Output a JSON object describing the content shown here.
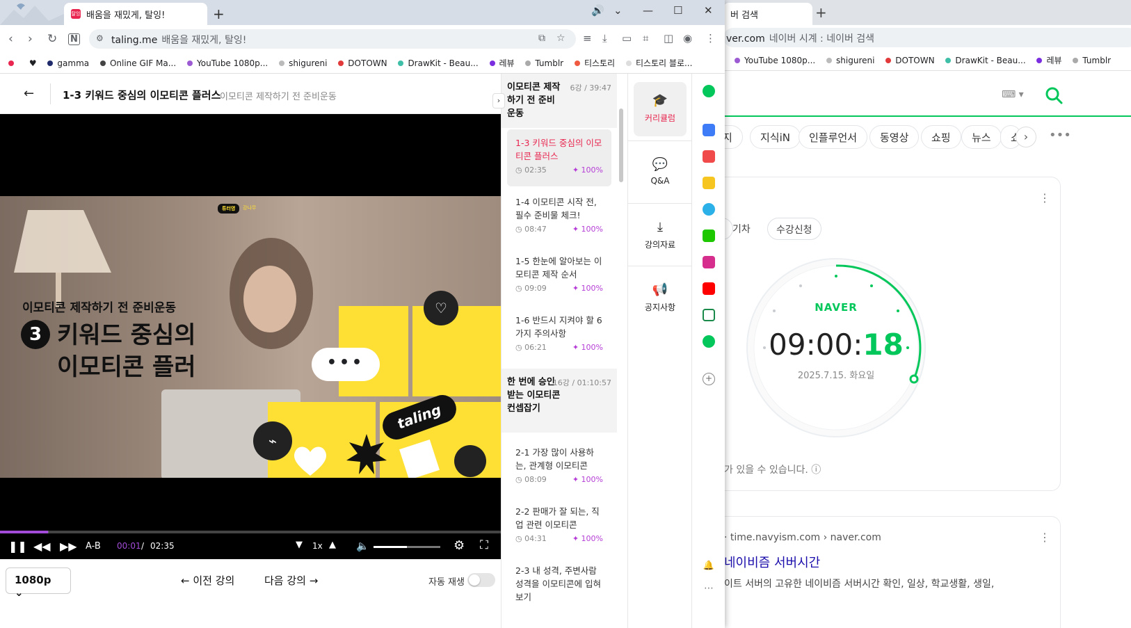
{
  "foreground": {
    "tab": {
      "title": "배움을 재밌게, 탈잉!",
      "favicon_text": "탈잉"
    },
    "new_tab_label": "+",
    "omnibox": {
      "host": "taling.me",
      "title": "배움을 재밌게, 탈잉!"
    },
    "bookmarks": [
      {
        "label": "",
        "color": "#e8264f"
      },
      {
        "label": "♥",
        "color": "#111111"
      },
      {
        "label": "gamma",
        "color": "#1f2b6b"
      },
      {
        "label": "Online GIF Ma...",
        "color": "#444444"
      },
      {
        "label": "YouTube 1080p...",
        "color": "#9c5bd3"
      },
      {
        "label": "shigureni",
        "color": "#bbbbbb"
      },
      {
        "label": "DOTOWN",
        "color": "#e23a3a"
      },
      {
        "label": "DrawKit - Beau...",
        "color": "#3fbfa7"
      },
      {
        "label": "레뷰",
        "color": "#7b2ee0"
      },
      {
        "label": "Tumblr",
        "color": "#aaaaaa"
      },
      {
        "label": "티스토리",
        "color": "#f05a40"
      },
      {
        "label": "티스토리 블로...",
        "color": "#dddddd"
      }
    ],
    "header": {
      "title": "1-3 키워드 중심의 이모티콘 플러스",
      "section": "이모티콘 제작하기 전 준비운동"
    },
    "video": {
      "overlay_subtitle": "이모티콘 제작하기 전 준비운동",
      "overlay_number": "3",
      "overlay_line1": "키워드 중심의",
      "overlay_line2": "이모티콘 플러",
      "badge": "튜터영",
      "badge_sub": "강나무",
      "bubble": "•••",
      "sticker": "taling",
      "progress": 0.096,
      "volume": 0.5
    },
    "controls": {
      "ab_label": "A-B",
      "time_current": "00:01",
      "time_sep": "/",
      "time_total": "02:35",
      "speed": "1x"
    },
    "bottom": {
      "quality": "1080p",
      "prev": "이전 강의",
      "next": "다음 강의",
      "autoplay_label": "자동 재생",
      "autoplay_on": false
    },
    "chapters": [
      {
        "title": "이모티콘 제작하기 전 준비운동",
        "meta": "6강 / 39:47"
      },
      {
        "title": "한 번에 승인받는 이모티콘 컨셉잡기",
        "meta": "16강 / 01:10:57"
      }
    ],
    "lessons": [
      {
        "title": "1-3 키워드 중심의 이모티콘 플러스",
        "duration": "02:35",
        "percent": "100%",
        "active": true
      },
      {
        "title": "1-4 이모티콘 시작 전, 필수 준비물 체크!",
        "duration": "08:47",
        "percent": "100%"
      },
      {
        "title": "1-5 한눈에 알아보는 이모티콘 제작 순서",
        "duration": "09:09",
        "percent": "100%"
      },
      {
        "title": "1-6 반드시 지켜야 할 6가지 주의사항",
        "duration": "06:21",
        "percent": "100%"
      },
      {
        "title": "2-1 가장 많이 사용하는, 관계형 이모티콘",
        "duration": "08:09",
        "percent": "100%"
      },
      {
        "title": "2-2 판매가 잘 되는, 직업 관련 이모티콘",
        "duration": "04:31",
        "percent": "100%"
      },
      {
        "title": "2-3 내 성격, 주변사람 성격을 이모티콘에 입혀보기",
        "duration": "",
        "percent": ""
      }
    ],
    "tools": [
      {
        "label": "커리큘럼",
        "icon": "graduation-cap-icon",
        "active": true
      },
      {
        "label": "Q&A",
        "icon": "chat-bubble-icon"
      },
      {
        "label": "강의자료",
        "icon": "download-icon"
      },
      {
        "label": "공지사항",
        "icon": "megaphone-icon"
      }
    ],
    "accent": "#e8264f",
    "progress_color": "#a24cd9"
  },
  "background": {
    "tab_title": "버 검색",
    "omnibox": {
      "host": "ver.com",
      "title": "네이버 시계 : 네이버 검색"
    },
    "bookmarks": [
      "YouTube 1080p...",
      "shigureni",
      "DOTOWN",
      "DrawKit - Beau...",
      "레뷰",
      "Tumblr"
    ],
    "tabs": [
      "지",
      "지식iN",
      "인플루언서",
      "동영상",
      "쇼핑",
      "뉴스",
      "쇼"
    ],
    "chips": [
      "기차",
      "수강신청"
    ],
    "clock": {
      "brand": "NAVER",
      "time_hm": "09:00:",
      "time_s": "18",
      "date": "2025.7.15. 화요일"
    },
    "note": "가 있을 수 있습니다.",
    "result": {
      "source": "· time.navyism.com › naver.com",
      "title": "네이비즘 서버시간",
      "desc": "이트 서버의 고유한 네이비즘 서버시간 확인, 일상, 학교생활, 생일,"
    },
    "brand_color": "#03c75a"
  }
}
